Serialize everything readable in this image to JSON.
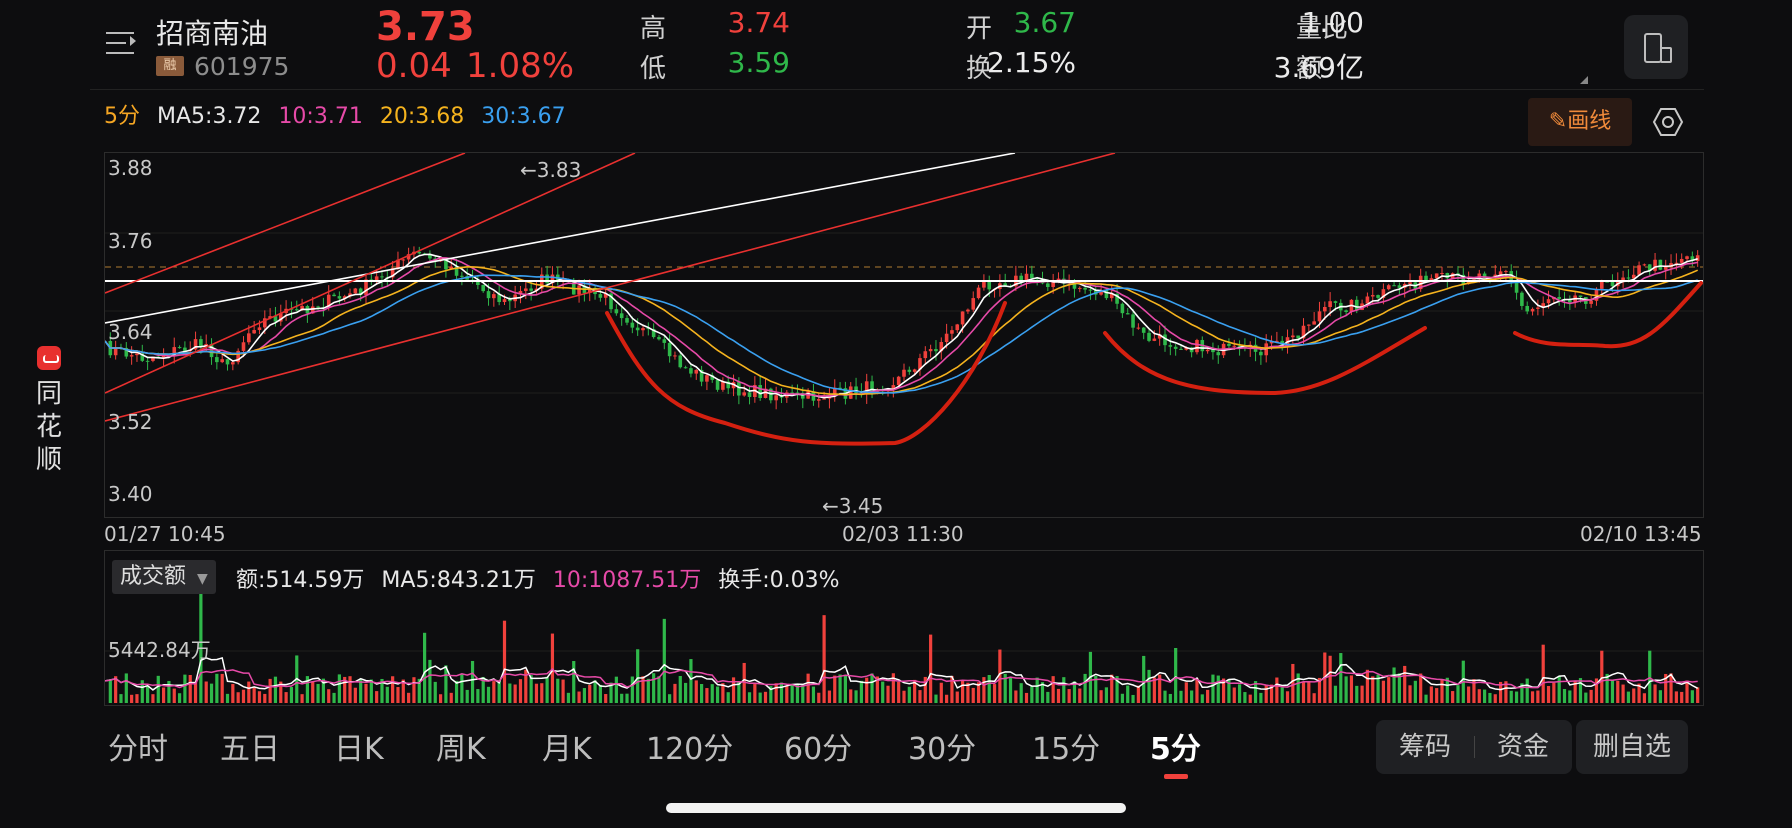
{
  "side_logo": {
    "chars": [
      "同",
      "花",
      "顺"
    ]
  },
  "header": {
    "stock_name": "招商南油",
    "badge": "融",
    "stock_code": "601975",
    "price": "3.73",
    "change": "0.04",
    "change_pct": "1.08%",
    "stats": [
      {
        "label": "高",
        "value": "3.74",
        "color": "#f0413c"
      },
      {
        "label": "低",
        "value": "3.59",
        "color": "#2fb84a"
      },
      {
        "label": "开",
        "value": "3.67",
        "color": "#2fb84a"
      },
      {
        "label": "换",
        "value": "2.15%",
        "color": "#ececec"
      },
      {
        "label": "量比",
        "value": "1.00",
        "color": "#ececec"
      },
      {
        "label": "额",
        "value": "3.69亿",
        "color": "#ececec"
      }
    ]
  },
  "ma_row": {
    "period": "5分",
    "ma5": "MA5:3.72",
    "ma10": "10:3.71",
    "ma20": "20:3.68",
    "ma30": "30:3.67",
    "colors": {
      "period": "#f5a623",
      "ma5": "#e8e8e8",
      "ma10": "#e64aa8",
      "ma20": "#f5b31e",
      "ma30": "#3aa0f0"
    }
  },
  "tools": {
    "draw_label": "画线"
  },
  "price_chart": {
    "y_labels": [
      "3.88",
      "3.76",
      "3.64",
      "3.52",
      "3.40"
    ],
    "high_marker": "←3.83",
    "low_marker": "←3.45",
    "x_labels": [
      "01/27 10:45",
      "02/03 11:30",
      "02/10 13:45"
    ],
    "colors": {
      "up": "#f0413c",
      "down": "#2fb84a",
      "ma5": "#ffffff",
      "ma10": "#e64aa8",
      "ma20": "#f5b31e",
      "ma30": "#3aa0f0",
      "trendline": "#e8302f",
      "drawing": "#d42010"
    }
  },
  "volume": {
    "selector": "成交额",
    "amount": "额:514.59万",
    "ma5": "MA5:843.21万",
    "ma10": "10:1087.51万",
    "turnover": "换手:0.03%",
    "max_label": "5442.84万"
  },
  "tabs": [
    {
      "label": "分时",
      "active": false
    },
    {
      "label": "五日",
      "active": false
    },
    {
      "label": "日K",
      "active": false
    },
    {
      "label": "周K",
      "active": false
    },
    {
      "label": "月K",
      "active": false
    },
    {
      "label": "120分",
      "active": false
    },
    {
      "label": "60分",
      "active": false
    },
    {
      "label": "30分",
      "active": false
    },
    {
      "label": "15分",
      "active": false
    },
    {
      "label": "5分",
      "active": true
    }
  ],
  "actions": {
    "chips": "筹码",
    "funds": "资金",
    "remove": "删自选"
  }
}
